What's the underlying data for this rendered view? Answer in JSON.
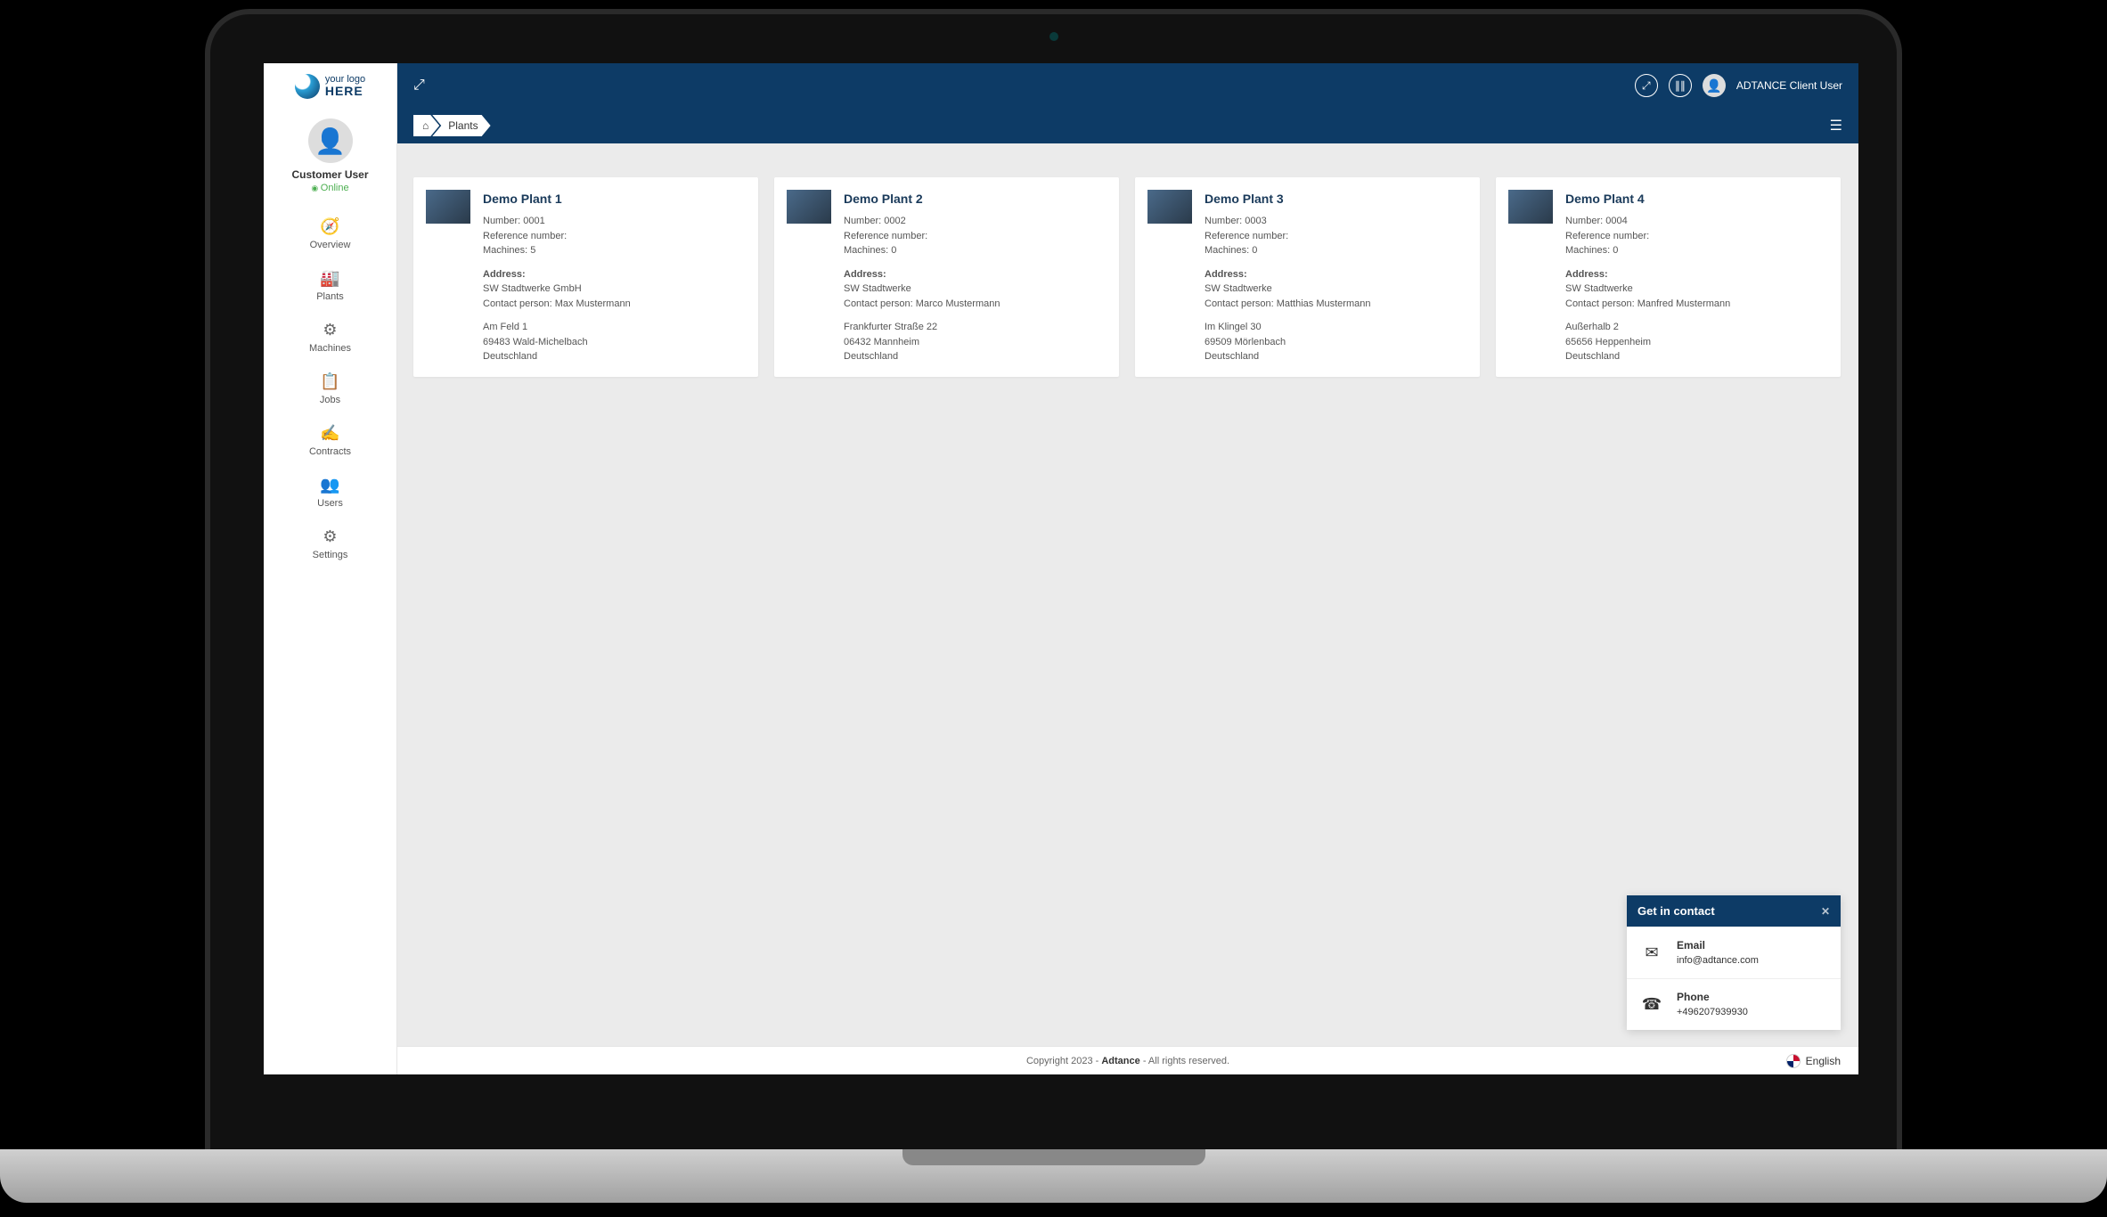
{
  "logo": {
    "line1": "your logo",
    "line2": "HERE"
  },
  "profile": {
    "name": "Customer User",
    "status": "Online"
  },
  "nav": [
    {
      "label": "Overview",
      "glyph": "🧭"
    },
    {
      "label": "Plants",
      "glyph": "🏭"
    },
    {
      "label": "Machines",
      "glyph": "⚙"
    },
    {
      "label": "Jobs",
      "glyph": "📋"
    },
    {
      "label": "Contracts",
      "glyph": "✍"
    },
    {
      "label": "Users",
      "glyph": "👥"
    },
    {
      "label": "Settings",
      "glyph": "⚙"
    }
  ],
  "header": {
    "user_name": "ADTANCE Client User"
  },
  "breadcrumb": {
    "home_glyph": "⌂",
    "current": "Plants"
  },
  "plants": [
    {
      "title": "Demo Plant 1",
      "number": "Number: 0001",
      "reference": "Reference number:",
      "machines": "Machines: 5",
      "address_label": "Address:",
      "company": "SW Stadtwerke GmbH",
      "contact": "Contact person: Max Mustermann",
      "street": "Am Feld 1",
      "city": "69483 Wald-Michelbach",
      "country": "Deutschland"
    },
    {
      "title": "Demo Plant 2",
      "number": "Number: 0002",
      "reference": "Reference number:",
      "machines": "Machines: 0",
      "address_label": "Address:",
      "company": "SW Stadtwerke",
      "contact": "Contact person: Marco Mustermann",
      "street": "Frankfurter Straße 22",
      "city": "06432 Mannheim",
      "country": "Deutschland"
    },
    {
      "title": "Demo Plant 3",
      "number": "Number: 0003",
      "reference": "Reference number:",
      "machines": "Machines: 0",
      "address_label": "Address:",
      "company": "SW Stadtwerke",
      "contact": "Contact person: Matthias Mustermann",
      "street": "Im Klingel 30",
      "city": "69509 Mörlenbach",
      "country": "Deutschland"
    },
    {
      "title": "Demo Plant 4",
      "number": "Number: 0004",
      "reference": "Reference number:",
      "machines": "Machines: 0",
      "address_label": "Address:",
      "company": "SW Stadtwerke",
      "contact": "Contact person: Manfred Mustermann",
      "street": "Außerhalb 2",
      "city": "65656 Heppenheim",
      "country": "Deutschland"
    }
  ],
  "contact_widget": {
    "title": "Get in contact",
    "email_label": "Email",
    "email_value": "info@adtance.com",
    "phone_label": "Phone",
    "phone_value": "+496207939930"
  },
  "footer": {
    "prefix": "Copyright 2023 - ",
    "brand": "Adtance",
    "suffix": " - All rights reserved."
  },
  "language": "English"
}
